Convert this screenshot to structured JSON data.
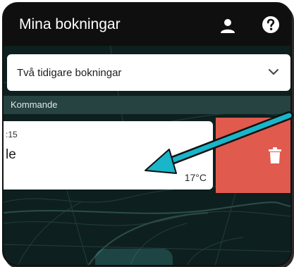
{
  "header": {
    "title": "Mina bokningar",
    "user_icon": "user-icon",
    "help_icon": "help-icon"
  },
  "filter": {
    "selected": "Två tidigare bokningar",
    "icon": "chevron-down-icon"
  },
  "section": {
    "label": "Kommande"
  },
  "booking": {
    "time": ":15",
    "name": "le",
    "temperature": "17°C"
  },
  "swipe_action": {
    "icon": "trash-icon",
    "color": "#e05a4e"
  },
  "colors": {
    "header": "#0f0f10",
    "map": "#0d1f1e",
    "section": "#264241",
    "arrow": "#19b5c9"
  }
}
